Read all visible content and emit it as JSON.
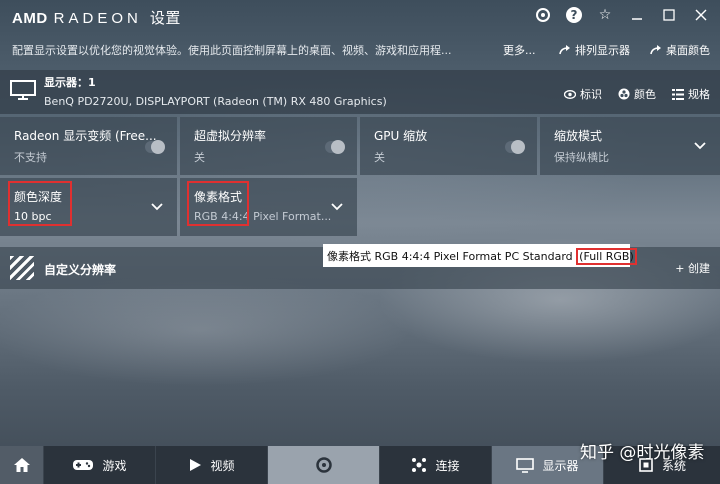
{
  "titlebar": {
    "brand": "AMD",
    "product": "RADEON",
    "section": "设置"
  },
  "subtitle": {
    "description": "配置显示设置以优化您的视觉体验。使用此页面控制屏幕上的桌面、视频、游戏和应用程...",
    "more": "更多...",
    "arrange_displays": "排列显示器",
    "desktop_color": "桌面颜色"
  },
  "display": {
    "label": "显示器：1",
    "model": "BenQ PD2720U, DISPLAYPORT (Radeon (TM) RX 480 Graphics)",
    "actions": {
      "identify": "标识",
      "color": "颜色",
      "specs": "规格"
    }
  },
  "tiles": [
    {
      "title": "Radeon 显示变频 (Free...",
      "value": "不支持"
    },
    {
      "title": "超虚拟分辨率",
      "value": "关"
    },
    {
      "title": "GPU 缩放",
      "value": "关"
    },
    {
      "title": "缩放模式",
      "value": "保持纵横比"
    },
    {
      "title": "颜色深度",
      "value": "10 bpc"
    },
    {
      "title": "像素格式",
      "value": "RGB 4:4:4 Pixel Format..."
    }
  ],
  "tooltip": {
    "main": "像素格式 RGB 4:4:4 Pixel Format PC Standard ",
    "highlight": "(Full RGB)"
  },
  "custom_resolution": {
    "label": "自定义分辨率",
    "create": "+ 创建"
  },
  "nav": {
    "games": "游戏",
    "video": "视频",
    "connect": "连接",
    "display": "显示器",
    "system": "系统"
  },
  "watermark": "知乎 @时光像素",
  "colors": {
    "highlight_box": "#e03030",
    "nav_active": "#6a7683"
  }
}
